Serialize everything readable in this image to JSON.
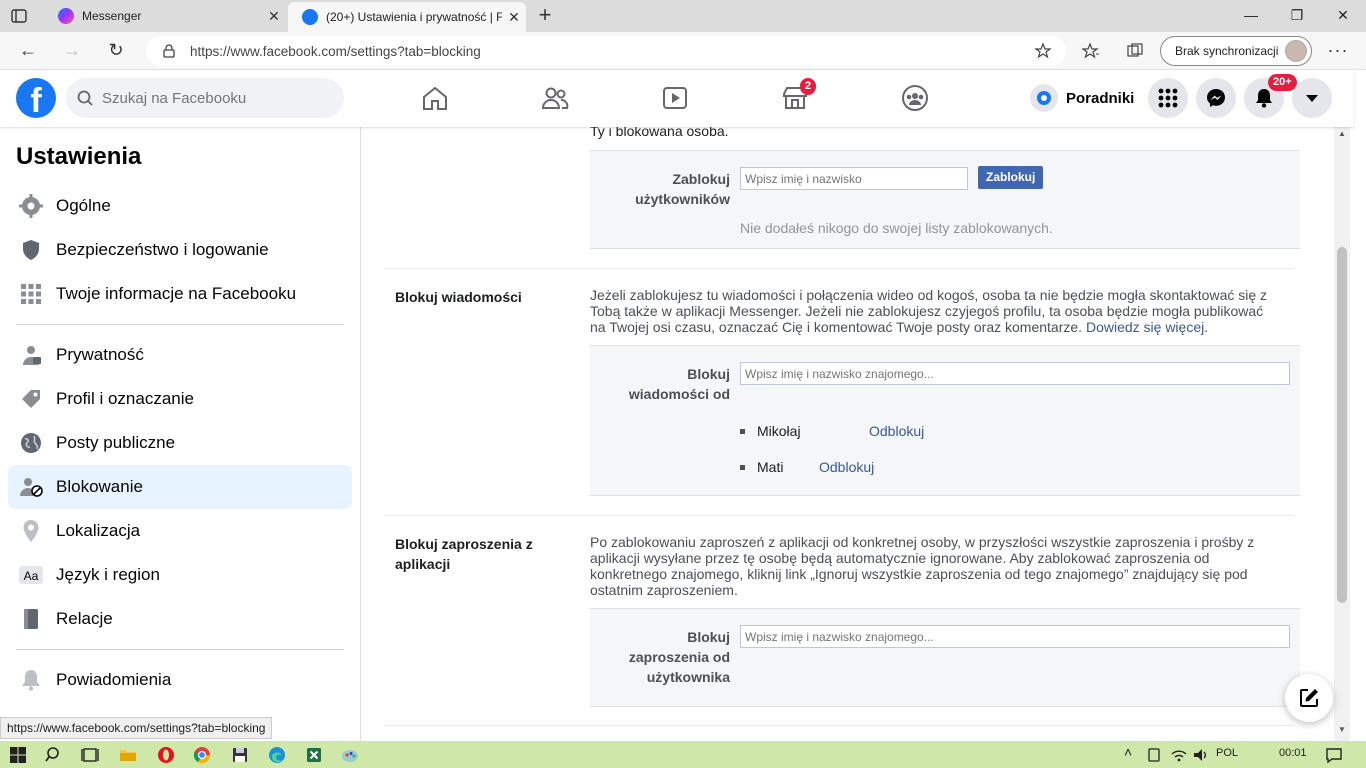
{
  "browser": {
    "tabs": [
      {
        "label": "Messenger"
      },
      {
        "label": "(20+) Ustawienia i prywatność | F"
      }
    ],
    "url": "https://www.facebook.com/settings?tab=blocking",
    "sync_label": "Brak synchronizacji",
    "status_url": "https://www.facebook.com/settings?tab=blocking"
  },
  "header": {
    "logo_letter": "f",
    "search_placeholder": "Szukaj na Facebooku",
    "marketplace_badge": "2",
    "notifications_badge": "20+",
    "guides_label": "Poradniki"
  },
  "sidebar": {
    "title": "Ustawienia",
    "items": [
      {
        "label": "Ogólne",
        "icon": "gear-icon"
      },
      {
        "label": "Bezpieczeństwo i logowanie",
        "icon": "shield-icon"
      },
      {
        "label": "Twoje informacje na Facebooku",
        "icon": "grid-icon"
      },
      {
        "label": "Prywatność",
        "icon": "lock-person-icon"
      },
      {
        "label": "Profil i oznaczanie",
        "icon": "tag-icon"
      },
      {
        "label": "Posty publiczne",
        "icon": "globe-icon"
      },
      {
        "label": "Blokowanie",
        "icon": "block-user-icon"
      },
      {
        "label": "Lokalizacja",
        "icon": "pin-icon"
      },
      {
        "label": "Język i region",
        "icon": "language-icon"
      },
      {
        "label": "Relacje",
        "icon": "book-icon"
      },
      {
        "label": "Powiadomienia",
        "icon": "bell-icon"
      }
    ],
    "active_index": 6
  },
  "main": {
    "top_partial_text": "Ty i blokowana osoba.",
    "block_users": {
      "label_line1": "Zablokuj",
      "label_line2": "użytkowników",
      "placeholder": "Wpisz imię i nazwisko",
      "button": "Zablokuj",
      "empty_text": "Nie dodałeś nikogo do swojej listy zablokowanych."
    },
    "block_messages": {
      "title": "Blokuj wiadomości",
      "desc_line1": "Jeżeli zablokujesz tu wiadomości i połączenia wideo od kogoś, osoba ta nie będzie mogła skontaktować się z",
      "desc_line2": "Tobą także w aplikacji Messenger. Jeżeli nie zablokujesz czyjegoś profilu, ta osoba będzie mogła publikować",
      "desc_line3": "na Twojej osi czasu, oznaczać Cię i komentować Twoje posty oraz komentarze.",
      "learn_more": "Dowiedz się więcej",
      "label_line1": "Blokuj",
      "label_line2": "wiadomości od",
      "placeholder": "Wpisz imię i nazwisko znajomego...",
      "blocked": [
        {
          "name": "Mikołaj",
          "action": "Odblokuj"
        },
        {
          "name": "Mati",
          "action": "Odblokuj"
        }
      ]
    },
    "block_invites": {
      "title_line1": "Blokuj zaproszenia z",
      "title_line2": "aplikacji",
      "desc_line1": "Po zablokowaniu zaproszeń z aplikacji od konkretnej osoby, w przyszłości wszystkie zaproszenia i prośby z",
      "desc_line2": "aplikacji wysyłane przez tę osobę będą automatycznie ignorowane. Aby zablokować zaproszenia od",
      "desc_line3": "konkretnego znajomego, kliknij link „Ignoruj wszystkie zaproszenia od tego znajomego” znajdujący się pod",
      "desc_line4": "ostatnim zaproszeniem.",
      "label_line1": "Blokuj",
      "label_line2": "zaproszenia od",
      "label_line3": "użytkownika",
      "placeholder": "Wpisz imię i nazwisko znajomego..."
    }
  },
  "taskbar": {
    "language": "POL",
    "time": "00:01"
  }
}
